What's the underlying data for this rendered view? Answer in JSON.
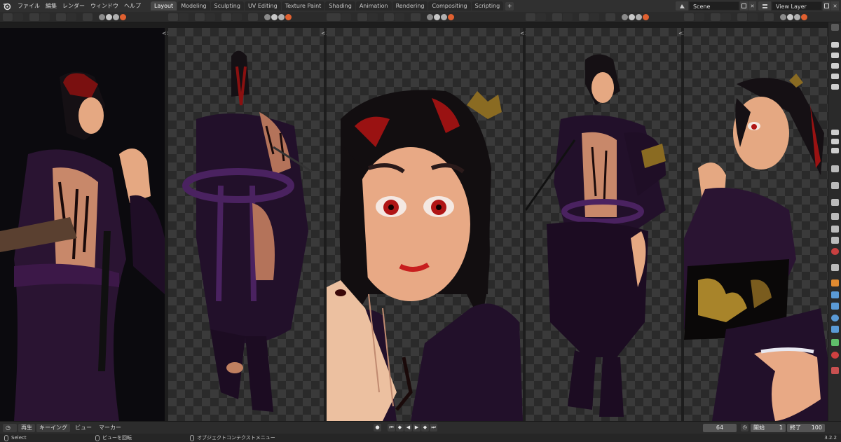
{
  "menu": [
    "ファイル",
    "編集",
    "レンダー",
    "ウィンドウ",
    "ヘルプ"
  ],
  "workspace_tabs": [
    "Layout",
    "Modeling",
    "Sculpting",
    "UV Editing",
    "Texture Paint",
    "Shading",
    "Animation",
    "Rendering",
    "Compositing",
    "Scripting"
  ],
  "active_tab": "Layout",
  "scene_name": "Scene",
  "view_layer_name": "View Layer",
  "timeline": {
    "playback_label": "再生",
    "keying_label": "キーイング",
    "view_label": "ビュー",
    "marker_label": "マーカー",
    "current_frame": "64",
    "start_label": "開始",
    "start_frame": "1",
    "end_label": "終了",
    "end_frame": "100"
  },
  "statusbar": {
    "select_label": "Select",
    "rotate_label": "ビューを回転",
    "context_menu_label": "オブジェクトコンテクストメニュー",
    "version": "3.2.2"
  },
  "viewports": [
    {
      "name": "viewport-1",
      "content": "render-three-quarter-fighting-pose"
    },
    {
      "name": "viewport-2",
      "content": "render-back-view"
    },
    {
      "name": "viewport-3",
      "content": "render-face-closeup"
    },
    {
      "name": "viewport-4",
      "content": "render-full-body-front"
    },
    {
      "name": "viewport-5",
      "content": "render-side-closeup"
    }
  ],
  "icons": [
    "blender-logo-icon",
    "scene-icon",
    "view-layer-icon",
    "camera-icon",
    "wrench-icon",
    "material-icon",
    "play-icon",
    "clock-icon",
    "mouse-icon"
  ],
  "colors": {
    "accent": "#e06030",
    "active_tab_bg": "#484848",
    "panel_bg": "#303030",
    "hair_red": "#b01515",
    "robe_purple": "#2a1432"
  }
}
